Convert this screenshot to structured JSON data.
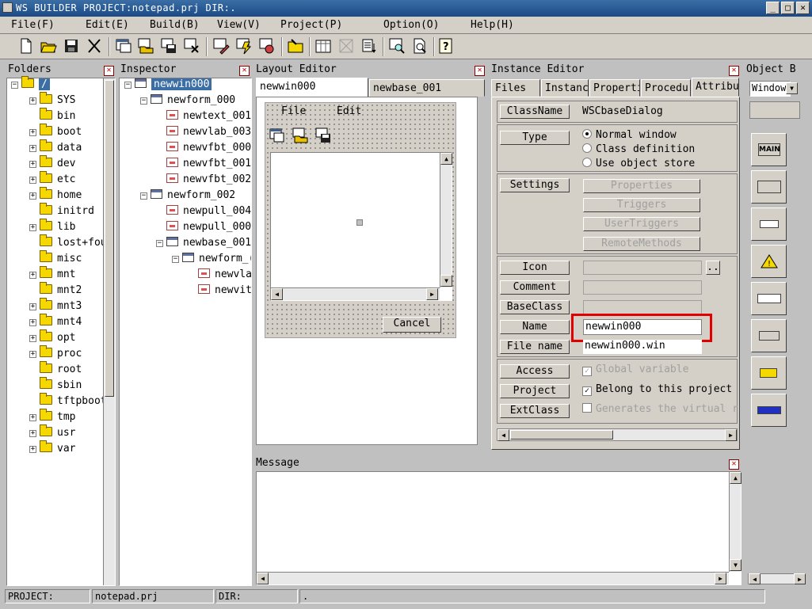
{
  "window": {
    "title": "WS BUILDER PROJECT:notepad.prj DIR:."
  },
  "menu": [
    {
      "label": "File(F)"
    },
    {
      "label": "Edit(E)"
    },
    {
      "label": "Build(B)"
    },
    {
      "label": "View(V)"
    },
    {
      "label": "Project(P)"
    },
    {
      "label": "Option(O)"
    },
    {
      "label": "Help(H)"
    }
  ],
  "panels": {
    "folders": "Folders",
    "inspector": "Inspector",
    "layout": "Layout Editor",
    "instance": "Instance Editor",
    "objectbox": "Object B",
    "message": "Message"
  },
  "folders": [
    "/",
    "SYS",
    "bin",
    "boot",
    "data",
    "dev",
    "etc",
    "home",
    "initrd",
    "lib",
    "lost+fou",
    "misc",
    "mnt",
    "mnt2",
    "mnt3",
    "mnt4",
    "opt",
    "proc",
    "root",
    "sbin",
    "tftpboot",
    "tmp",
    "usr",
    "var"
  ],
  "inspector": [
    "newwin000",
    "newform_000",
    "newtext_001",
    "newvlab_003",
    "newvfbt_000",
    "newvfbt_001",
    "newvfbt_002",
    "newform_002",
    "newpull_004",
    "newpull_000",
    "newbase_001",
    "newform_(",
    "newvla",
    "newvit"
  ],
  "layout": {
    "tabs": [
      "newwin000",
      "newbase_001"
    ],
    "menu": [
      "File",
      "Edit"
    ],
    "cancel": "Cancel"
  },
  "instance": {
    "tabs": [
      "Files",
      "Instance",
      "Properti",
      "Procedur",
      "Attribut"
    ],
    "classname_label": "ClassName",
    "classname_value": "WSCbaseDialog",
    "type_label": "Type",
    "type_options": [
      "Normal window",
      "Class definition",
      "Use object store"
    ],
    "settings_label": "Settings",
    "settings_buttons": [
      "Properties",
      "Triggers",
      "UserTriggers",
      "RemoteMethods"
    ],
    "icon_label": "Icon",
    "browse": "..",
    "comment_label": "Comment",
    "baseclass_label": "BaseClass",
    "name_label": "Name",
    "name_value": "newwin000",
    "filename_label": "File name",
    "filename_value": "newwin000.win",
    "access_label": "Access",
    "access_option": "Global variable",
    "project_label": "Project",
    "project_option": "Belong to this project",
    "extclass_label": "ExtClass",
    "extclass_option": "Generates the virtual remo"
  },
  "objectbox": {
    "select_value": "Window",
    "main": "MAIN"
  },
  "status": {
    "project_label": "PROJECT:",
    "project_value": "notepad.prj",
    "dir_label": "DIR:",
    "dir_value": "."
  }
}
